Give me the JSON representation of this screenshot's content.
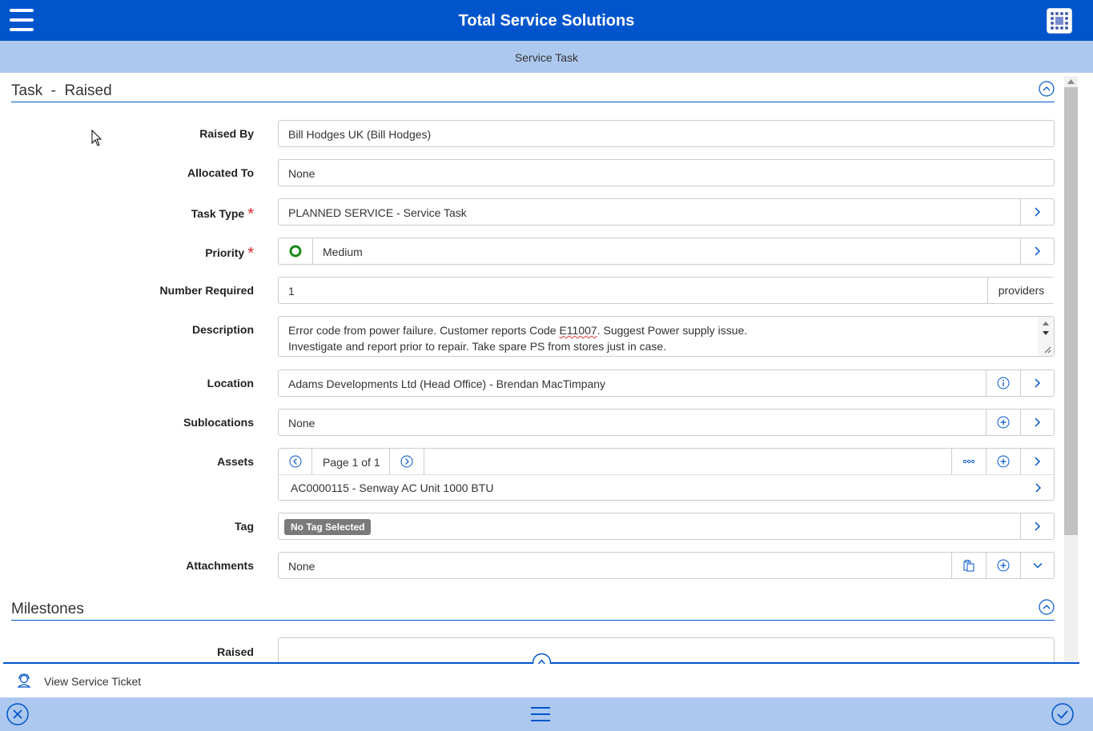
{
  "header": {
    "title": "Total Service Solutions",
    "subtitle": "Service Task"
  },
  "section": {
    "title": "Task  -  Raised"
  },
  "fields": {
    "raised_by": {
      "label": "Raised By",
      "value": "Bill Hodges UK (Bill Hodges)"
    },
    "allocated_to": {
      "label": "Allocated To",
      "value": "None"
    },
    "task_type": {
      "label": "Task Type",
      "value": "PLANNED SERVICE - Service Task",
      "required": "*"
    },
    "priority": {
      "label": "Priority",
      "value": "Medium",
      "required": "*",
      "status_color": "#1a8a1a"
    },
    "number_required": {
      "label": "Number Required",
      "value": "1",
      "suffix": "providers"
    },
    "description": {
      "label": "Description",
      "line1_before": "Error code from power failure.  Customer reports Code ",
      "line1_code": "E11007",
      "line1_after": ". Suggest Power supply issue.",
      "line2": "Investigate and report prior to repair.  Take spare PS from stores just in case."
    },
    "location": {
      "label": "Location",
      "value": "Adams Developments Ltd (Head Office) - Brendan MacTimpany"
    },
    "sublocations": {
      "label": "Sublocations",
      "value": "None"
    },
    "assets": {
      "label": "Assets",
      "page": "Page 1 of 1",
      "item": "AC0000115 - Senway AC Unit 1000 BTU"
    },
    "tag": {
      "label": "Tag",
      "value": "No Tag Selected"
    },
    "attachments": {
      "label": "Attachments",
      "value": "None"
    }
  },
  "milestones": {
    "title": "Milestones",
    "raised_label": "Raised"
  },
  "bottom": {
    "ticket_label": "View Service Ticket"
  },
  "colors": {
    "primary": "#0055cc",
    "light": "#adc8ef",
    "required": "#e0202a"
  }
}
